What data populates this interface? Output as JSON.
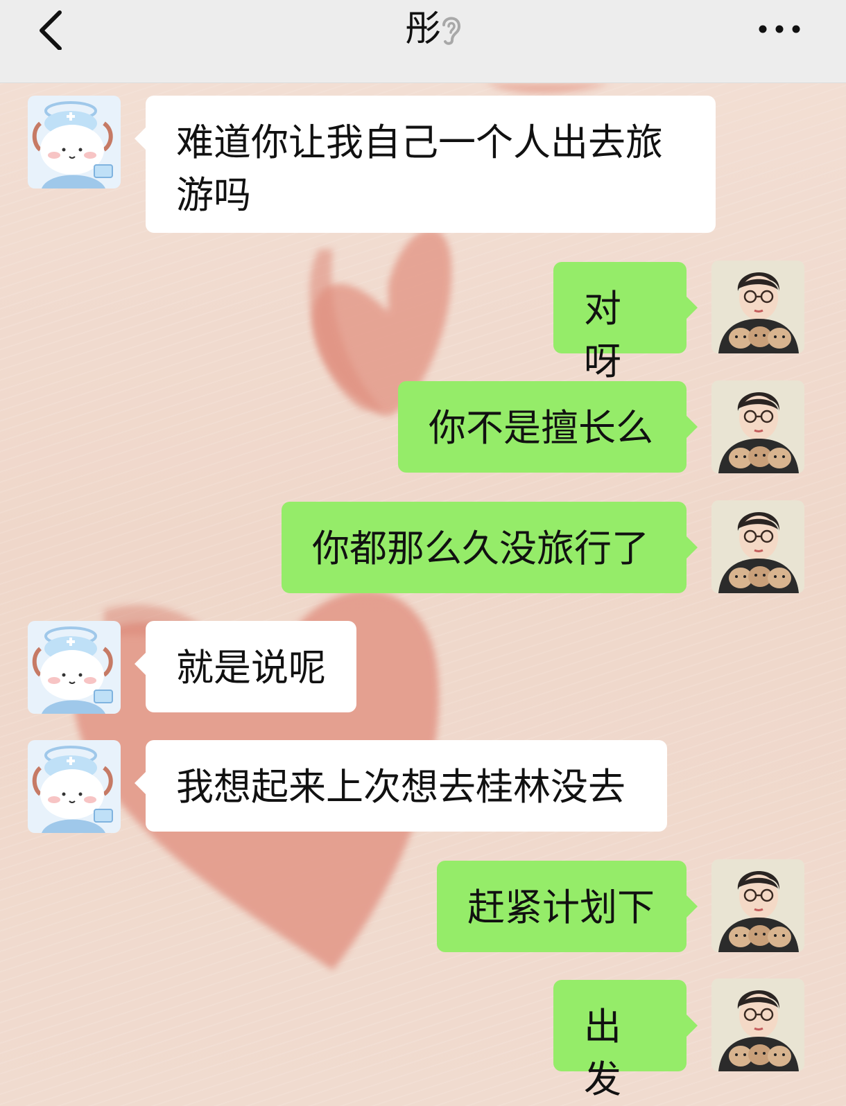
{
  "header": {
    "title": "彤",
    "back_icon": "chevron-left-icon",
    "mute_icon": "ear-icon",
    "more_icon": "more-dots-icon",
    "background": "#ededed"
  },
  "colors": {
    "incoming_bubble": "#ffffff",
    "outgoing_bubble": "#95ec69",
    "wallpaper_heart": "#e39a8a"
  },
  "contact_avatar_icon": "cartoon-nurse-avatar",
  "self_avatar_icon": "girl-with-cats-avatar",
  "messages": [
    {
      "side": "left",
      "text": "难道你让我自己一个人出去旅\n游吗"
    },
    {
      "side": "right",
      "text": "对呀"
    },
    {
      "side": "right",
      "text": "你不是擅长么"
    },
    {
      "side": "right",
      "text": "你都那么久没旅行了"
    },
    {
      "side": "left",
      "text": "就是说呢"
    },
    {
      "side": "left",
      "text": "我想起来上次想去桂林没去"
    },
    {
      "side": "right",
      "text": "赶紧计划下"
    },
    {
      "side": "right",
      "text": "出发"
    }
  ]
}
